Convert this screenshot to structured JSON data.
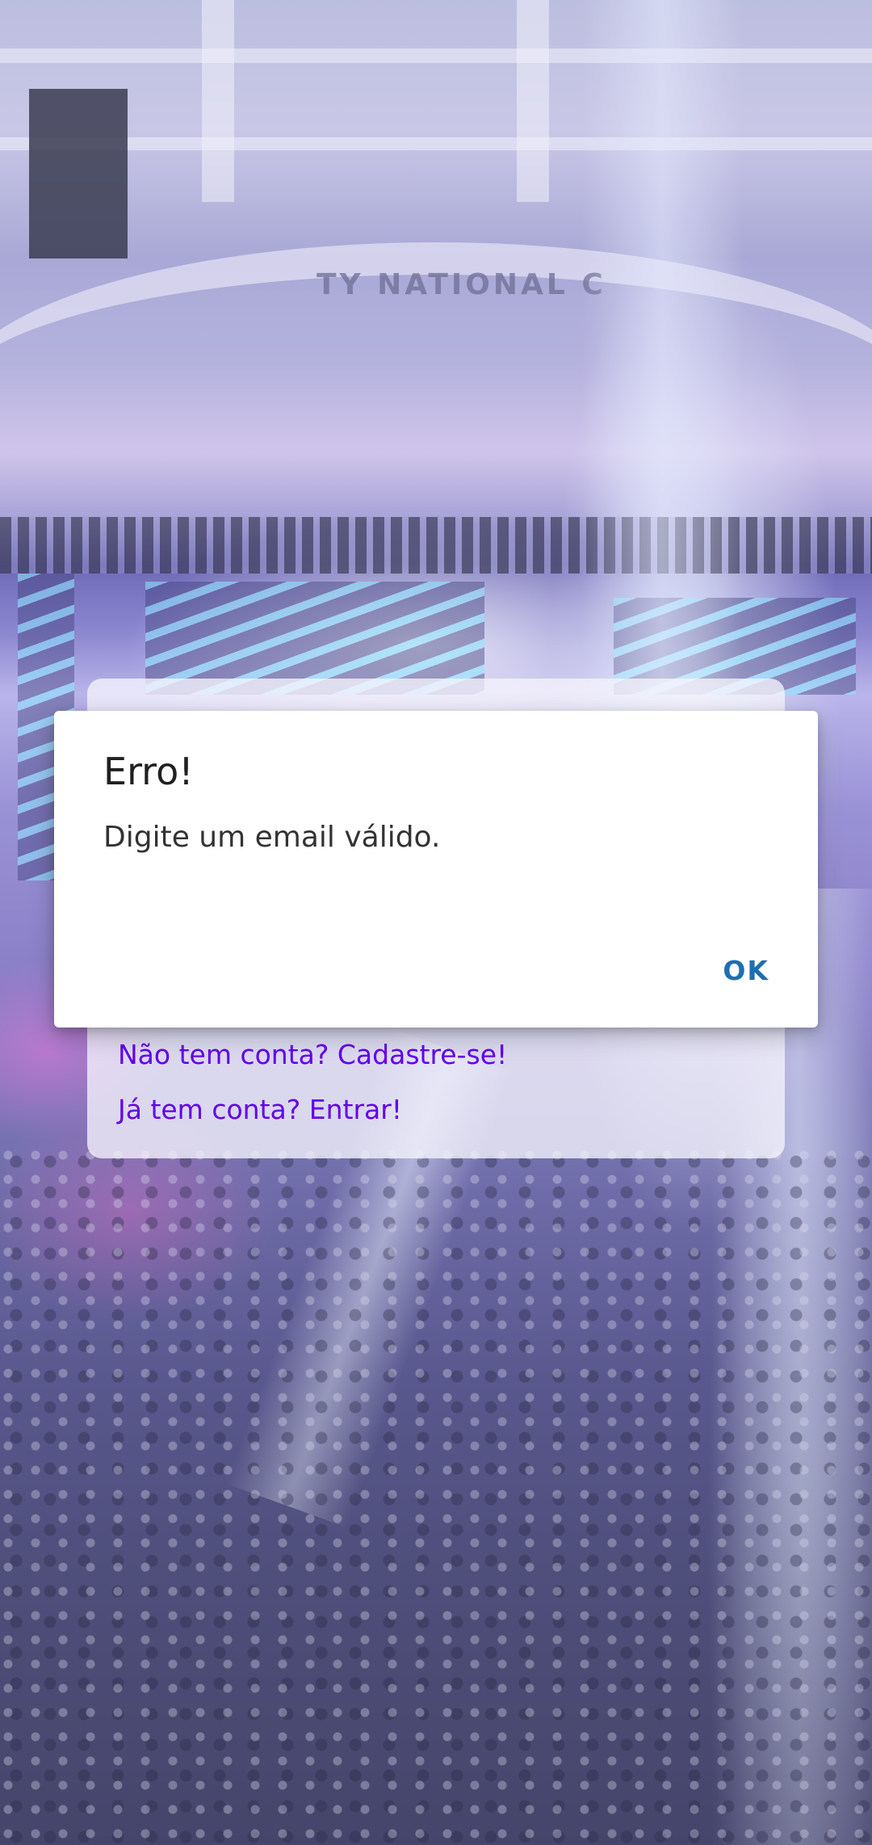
{
  "background": {
    "arch_sign_text": "TY NATIONAL C"
  },
  "card": {
    "signup_link": "Não tem conta? Cadastre-se!",
    "login_link": "Já tem conta? Entrar!"
  },
  "dialog": {
    "title": "Erro!",
    "message": "Digite um email válido.",
    "ok_label": "OK"
  },
  "colors": {
    "link": "#6200ea",
    "dialog_button": "#1e6fb0",
    "dialog_background": "#ffffff"
  }
}
